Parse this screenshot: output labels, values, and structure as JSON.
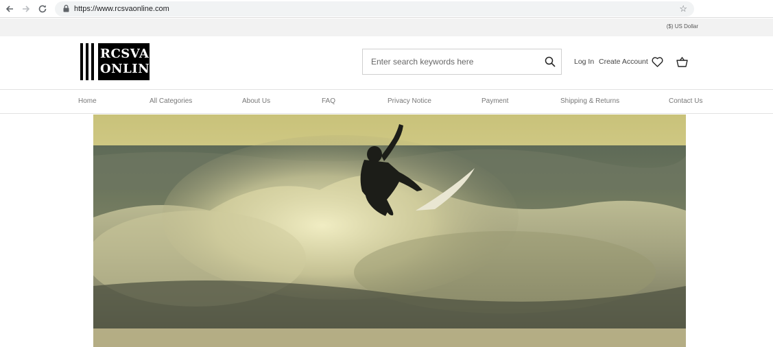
{
  "browser": {
    "url": "https://www.rcsvaonline.com"
  },
  "topbar": {
    "currency": "($) US Dollar"
  },
  "logo": {
    "line1": "RCSVA",
    "line2": "ONLINE"
  },
  "search": {
    "placeholder": "Enter search keywords here"
  },
  "account": {
    "login": "Log In",
    "create": "Create Account"
  },
  "nav": {
    "items": [
      {
        "label": "Home"
      },
      {
        "label": "All Categories"
      },
      {
        "label": "About Us"
      },
      {
        "label": "FAQ"
      },
      {
        "label": "Privacy Notice"
      },
      {
        "label": "Payment"
      },
      {
        "label": "Shipping & Returns"
      },
      {
        "label": "Contact Us"
      }
    ]
  },
  "icons": {
    "back": "back-arrow-icon",
    "forward": "forward-arrow-icon",
    "reload": "reload-icon",
    "lock": "lock-icon",
    "bookmark": "star-icon",
    "search": "search-icon",
    "wishlist": "heart-icon",
    "cart": "basket-icon"
  },
  "colors": {
    "accent": "#000000",
    "currency_bar": "#f2f2f2",
    "nav_text": "#777777"
  }
}
